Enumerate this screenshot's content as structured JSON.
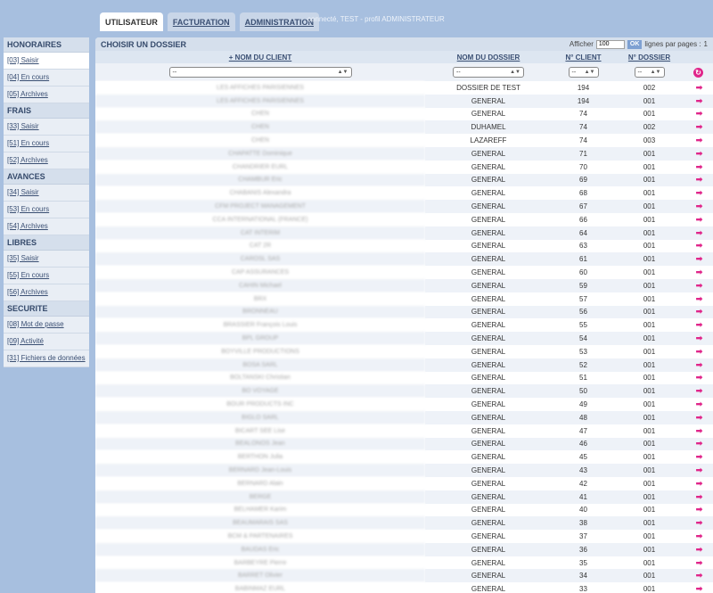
{
  "tabs": [
    {
      "label": "UTILISATEUR",
      "active": true
    },
    {
      "label": "FACTURATION",
      "active": false
    },
    {
      "label": "ADMINISTRATION",
      "active": false
    }
  ],
  "status_text": "connecté, TEST - profil ADMINISTRATEUR",
  "sidebar": {
    "sections": [
      {
        "title": "HONORAIRES",
        "items": [
          {
            "label": "[03] Saisir",
            "active": true
          },
          {
            "label": "[04] En cours"
          },
          {
            "label": "[05] Archives"
          }
        ]
      },
      {
        "title": "FRAIS",
        "items": [
          {
            "label": "[33] Saisir"
          },
          {
            "label": "[51] En cours"
          },
          {
            "label": "[52] Archives"
          }
        ]
      },
      {
        "title": "AVANCES",
        "items": [
          {
            "label": "[34] Saisir"
          },
          {
            "label": "[53] En cours"
          },
          {
            "label": "[54] Archives"
          }
        ]
      },
      {
        "title": "LIBRES",
        "items": [
          {
            "label": "[35] Saisir"
          },
          {
            "label": "[55] En cours"
          },
          {
            "label": "[56] Archives"
          }
        ]
      },
      {
        "title": "SECURITE",
        "items": [
          {
            "label": "[08] Mot de passe"
          },
          {
            "label": "[09] Activité"
          },
          {
            "label": "[31] Fichiers de données"
          }
        ]
      }
    ]
  },
  "main": {
    "title": "CHOISIR UN DOSSIER",
    "pager": {
      "label_before": "Afficher",
      "value": "100",
      "ok_label": "OK",
      "label_after": "lignes par pages :",
      "page": "1"
    },
    "columns": {
      "client": "+ NOM DU CLIENT",
      "dossier": "NOM DU DOSSIER",
      "num_client": "N° CLIENT",
      "num_dossier": "N° DOSSIER"
    },
    "filter_placeholder": "--",
    "rows": [
      {
        "client": "LES AFFICHES PARISIENNES",
        "dossier": "DOSSIER DE TEST",
        "num_client": "194",
        "num_dossier": "002"
      },
      {
        "client": "LES AFFICHES PARISIENNES",
        "dossier": "GENERAL",
        "num_client": "194",
        "num_dossier": "001"
      },
      {
        "client": "CHEN",
        "dossier": "GENERAL",
        "num_client": "74",
        "num_dossier": "001"
      },
      {
        "client": "CHEN",
        "dossier": "DUHAMEL",
        "num_client": "74",
        "num_dossier": "002"
      },
      {
        "client": "CHEN",
        "dossier": "LAZAREFF",
        "num_client": "74",
        "num_dossier": "003"
      },
      {
        "client": "CHAPATTE Dominique",
        "dossier": "GENERAL",
        "num_client": "71",
        "num_dossier": "001"
      },
      {
        "client": "CHANDRIER EURL",
        "dossier": "GENERAL",
        "num_client": "70",
        "num_dossier": "001"
      },
      {
        "client": "CHAMBUR Eric",
        "dossier": "GENERAL",
        "num_client": "69",
        "num_dossier": "001"
      },
      {
        "client": "CHABANIS Alexandra",
        "dossier": "GENERAL",
        "num_client": "68",
        "num_dossier": "001"
      },
      {
        "client": "CFM PROJECT MANAGEMENT",
        "dossier": "GENERAL",
        "num_client": "67",
        "num_dossier": "001"
      },
      {
        "client": "CCA INTERNATIONAL (FRANCE)",
        "dossier": "GENERAL",
        "num_client": "66",
        "num_dossier": "001"
      },
      {
        "client": "CAT INTERIM",
        "dossier": "GENERAL",
        "num_client": "64",
        "num_dossier": "001"
      },
      {
        "client": "CAT 2R",
        "dossier": "GENERAL",
        "num_client": "63",
        "num_dossier": "001"
      },
      {
        "client": "CAROSL SAS",
        "dossier": "GENERAL",
        "num_client": "61",
        "num_dossier": "001"
      },
      {
        "client": "CAP ASSURANCES",
        "dossier": "GENERAL",
        "num_client": "60",
        "num_dossier": "001"
      },
      {
        "client": "CAHIN Michael",
        "dossier": "GENERAL",
        "num_client": "59",
        "num_dossier": "001"
      },
      {
        "client": "BRX",
        "dossier": "GENERAL",
        "num_client": "57",
        "num_dossier": "001"
      },
      {
        "client": "BRONNEAU",
        "dossier": "GENERAL",
        "num_client": "56",
        "num_dossier": "001"
      },
      {
        "client": "BRASSIER François Louis",
        "dossier": "GENERAL",
        "num_client": "55",
        "num_dossier": "001"
      },
      {
        "client": "BPL GROUP",
        "dossier": "GENERAL",
        "num_client": "54",
        "num_dossier": "001"
      },
      {
        "client": "BOYVILLE PRODUCTIONS",
        "dossier": "GENERAL",
        "num_client": "53",
        "num_dossier": "001"
      },
      {
        "client": "BOSA SARL",
        "dossier": "GENERAL",
        "num_client": "52",
        "num_dossier": "001"
      },
      {
        "client": "BOLTANSKI Christian",
        "dossier": "GENERAL",
        "num_client": "51",
        "num_dossier": "001"
      },
      {
        "client": "BO VOYAGE",
        "dossier": "GENERAL",
        "num_client": "50",
        "num_dossier": "001"
      },
      {
        "client": "BOUR PRODUCTS INC",
        "dossier": "GENERAL",
        "num_client": "49",
        "num_dossier": "001"
      },
      {
        "client": "BIGLO SARL",
        "dossier": "GENERAL",
        "num_client": "48",
        "num_dossier": "001"
      },
      {
        "client": "BICART SEE Lise",
        "dossier": "GENERAL",
        "num_client": "47",
        "num_dossier": "001"
      },
      {
        "client": "BEALONOS Jean",
        "dossier": "GENERAL",
        "num_client": "46",
        "num_dossier": "001"
      },
      {
        "client": "BERTHON Julia",
        "dossier": "GENERAL",
        "num_client": "45",
        "num_dossier": "001"
      },
      {
        "client": "BERNARD Jean-Louis",
        "dossier": "GENERAL",
        "num_client": "43",
        "num_dossier": "001"
      },
      {
        "client": "BERNARD Alain",
        "dossier": "GENERAL",
        "num_client": "42",
        "num_dossier": "001"
      },
      {
        "client": "BERGE",
        "dossier": "GENERAL",
        "num_client": "41",
        "num_dossier": "001"
      },
      {
        "client": "BELHAMER Karim",
        "dossier": "GENERAL",
        "num_client": "40",
        "num_dossier": "001"
      },
      {
        "client": "BEAUMARAIS SAS",
        "dossier": "GENERAL",
        "num_client": "38",
        "num_dossier": "001"
      },
      {
        "client": "BCM & PARTENAIRES",
        "dossier": "GENERAL",
        "num_client": "37",
        "num_dossier": "001"
      },
      {
        "client": "BAUDAS Eric",
        "dossier": "GENERAL",
        "num_client": "36",
        "num_dossier": "001"
      },
      {
        "client": "BARBEYRE Pierre",
        "dossier": "GENERAL",
        "num_client": "35",
        "num_dossier": "001"
      },
      {
        "client": "BARRET Olivier",
        "dossier": "GENERAL",
        "num_client": "34",
        "num_dossier": "001"
      },
      {
        "client": "BABINMAZ EURL",
        "dossier": "GENERAL",
        "num_client": "33",
        "num_dossier": "001"
      }
    ]
  },
  "colors": {
    "accent": "#e0258a",
    "background": "#a7bfdf",
    "header": "#d5dfec"
  },
  "icons": {
    "row_action": "arrow-right-icon",
    "reset": "refresh-icon"
  }
}
